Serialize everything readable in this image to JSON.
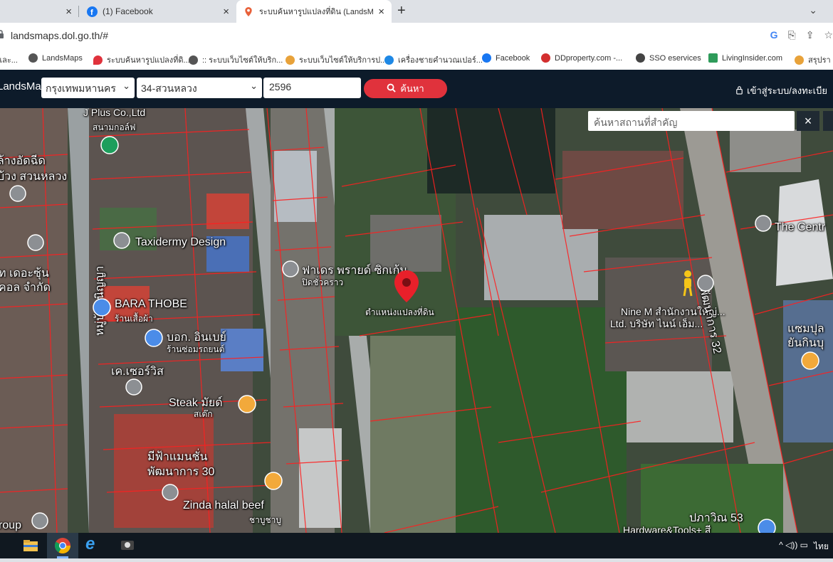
{
  "tabs": [
    {
      "label": "",
      "close": "×"
    },
    {
      "label": "(1) Facebook",
      "close": "×"
    },
    {
      "label": "ระบบค้นหารูปแปลงที่ดิน (LandsMap",
      "close": "×"
    }
  ],
  "new_tab": "+",
  "tab_menu": "⌄",
  "address": {
    "url": "landsmaps.dol.go.th/#"
  },
  "bookmarks": [
    {
      "label": "และ...",
      "color": "#888"
    },
    {
      "label": "LandsMaps",
      "color": "#555"
    },
    {
      "label": "ระบบค้นหารูปแปลงที่ดิ...",
      "color": "#e0323c"
    },
    {
      "label": ":: ระบบเว็บไซต์ให้บริก...",
      "color": "#555"
    },
    {
      "label": "ระบบเว็บไซต์ให้บริการป...",
      "color": "#e8a23a"
    },
    {
      "label": "เครื่องชายคำนวณเปอร์...",
      "color": "#1e88e5"
    },
    {
      "label": "Facebook",
      "color": "#1877f2"
    },
    {
      "label": "DDproperty.com -...",
      "color": "#d32f2f"
    },
    {
      "label": "SSO eservices",
      "color": "#444"
    },
    {
      "label": "LivingInsider.com",
      "color": "#2e9b5a"
    },
    {
      "label": "สรุปรา",
      "color": "#e8a23a"
    }
  ],
  "appbar": {
    "brand": "LandsMaps",
    "province": "กรุงเทพมหานคร",
    "district": "34-สวนหลวง",
    "parcel_no": "2596",
    "search_label": "ค้นหา",
    "login_label": "เข้าสู่ระบบ/ลงทะเบีย"
  },
  "map": {
    "place_search_placeholder": "ค้นหาสถานที่สำคัญ",
    "close_label": "×",
    "labels": {
      "jplus": "J Plus Co.,Ltd",
      "jplus_sub": "สนามกอล์ฟ",
      "laundry": "ล้างอัดฉีด",
      "laundry2": "บ้วง สวนหลวง",
      "taxidermy": "Taxidermy Design",
      "ted": "ท เดอะซุ้น",
      "ted2": "คอล จำกัด",
      "pharmacy": "ฟาเดร พรายด์ ซิกเก้น",
      "pharmacy_sub": "ปิดชั่วคราว",
      "parcel": "ตำแหน่งแปลงที่ดิน",
      "bara": "BARA THOBE",
      "bara_sub": "ร้านเสื้อผ้า",
      "bokoh": "บอก. อินเบย์",
      "bokoh_sub": "ร้านซ่อมรถยนต์",
      "kservice": "เค.เซอร์วิส",
      "steak": "Steak มัยด์",
      "steak_sub": "สเต๊ก",
      "mifa": "มีฟ้าแมนชั่น",
      "mifa2": "พัฒนาการ 30",
      "zinda": "Zinda halal beef",
      "zinda_sub": "ชาบูชาบู",
      "group": "roup",
      "nine": "Nine M สำนักงานใหญ่...",
      "nine2": "Ltd. บริษัท ไนน์ เอ็ม...",
      "road_pattanakarn": "พัฒนาการ 32",
      "road_left": "หมู่บ้านนิญญา",
      "central": "The Centr",
      "shabu": "แซมปุล",
      "shabu2": "ยันกินบุ",
      "pawin": "ปภาวิณ 53",
      "hardware": "Hardware&Tools+ สี"
    }
  },
  "taskbar": {
    "tray_lang": "ไทย",
    "tray_symbols": "^ ◁)) ▭"
  }
}
